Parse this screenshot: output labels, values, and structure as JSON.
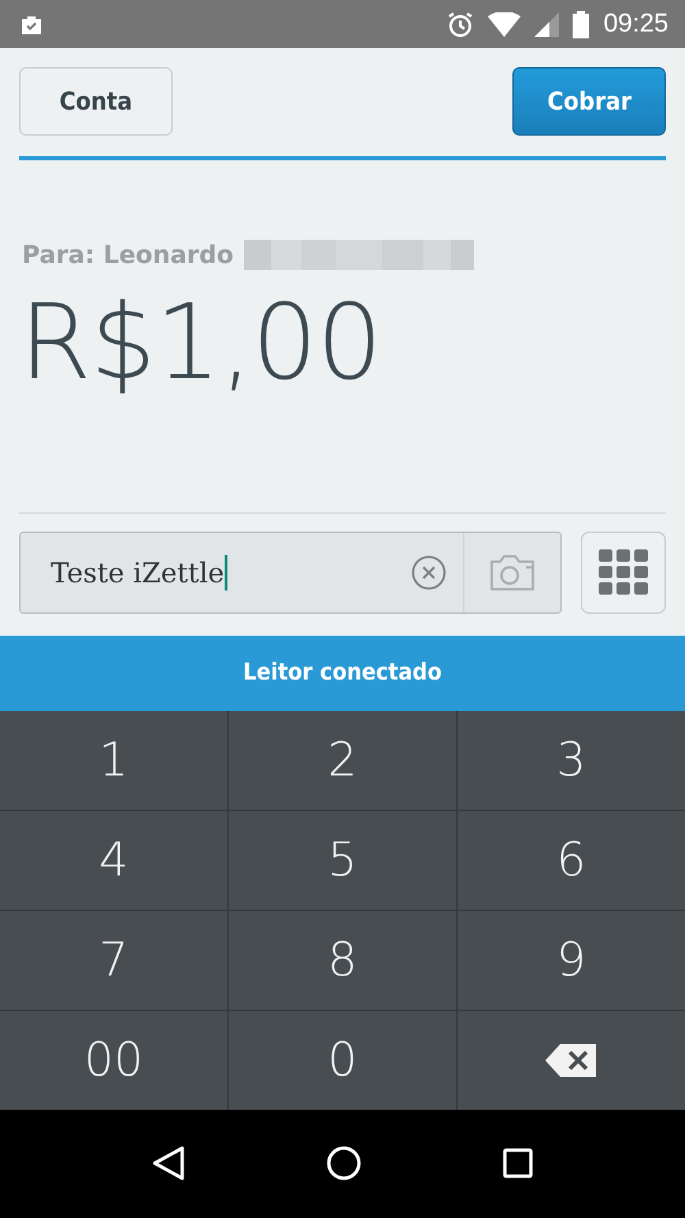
{
  "status_bar": {
    "time": "09:25"
  },
  "header": {
    "left_button": "Conta",
    "right_button": "Cobrar"
  },
  "recipient": {
    "label": "Para: Leonardo",
    "redacted": true
  },
  "amount": "R$1,00",
  "description_field": {
    "value": "Teste iZettle",
    "focused": true
  },
  "banner": "Leitor conectado",
  "keypad": [
    {
      "kind": "digit",
      "label": "1"
    },
    {
      "kind": "digit",
      "label": "2"
    },
    {
      "kind": "digit",
      "label": "3"
    },
    {
      "kind": "digit",
      "label": "4"
    },
    {
      "kind": "digit",
      "label": "5"
    },
    {
      "kind": "digit",
      "label": "6"
    },
    {
      "kind": "digit",
      "label": "7"
    },
    {
      "kind": "digit",
      "label": "8"
    },
    {
      "kind": "digit",
      "label": "9"
    },
    {
      "kind": "digit",
      "label": "00"
    },
    {
      "kind": "digit",
      "label": "0"
    },
    {
      "kind": "backspace"
    }
  ]
}
